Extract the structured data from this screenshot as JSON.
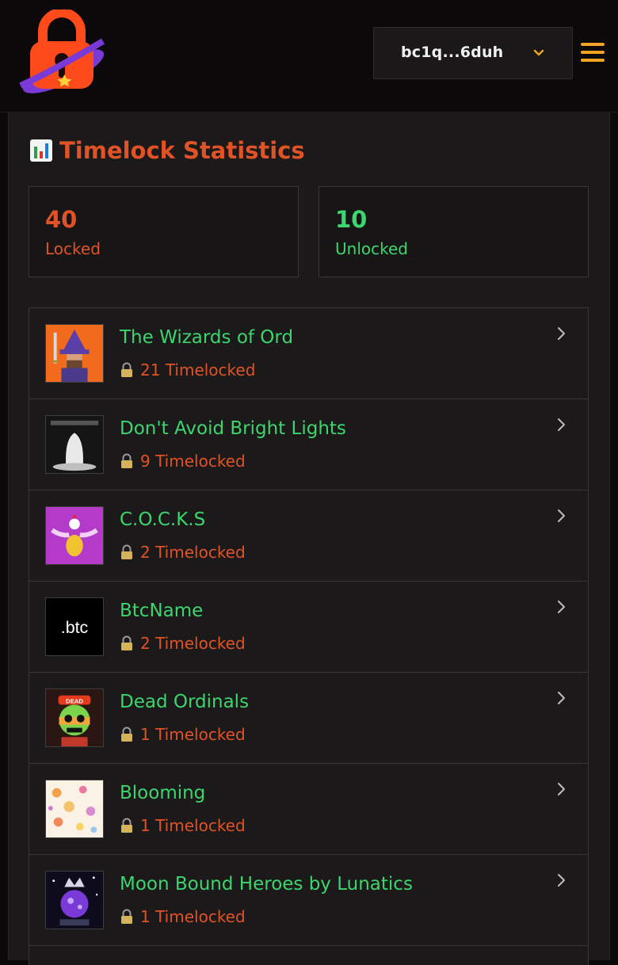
{
  "header": {
    "logo_icon": "padlock-planet-logo",
    "wallet_address": "bc1q...6duh",
    "wallet_dropdown_icon": "chevron-down-icon",
    "menu_icon": "hamburger-menu-icon",
    "accent_color": "#f3a321"
  },
  "stats": {
    "title_icon": "bar-chart-icon",
    "title": "Timelock Statistics",
    "locked": {
      "value": "40",
      "label": "Locked",
      "color": "#e05326"
    },
    "unlocked": {
      "value": "10",
      "label": "Unlocked",
      "color": "#3dd56d"
    }
  },
  "collections": [
    {
      "name": "The Wizards of Ord",
      "count": "21 Timelocked",
      "thumb": "wizard-pixel-art"
    },
    {
      "name": "Don't Avoid Bright Lights",
      "count": "9 Timelocked",
      "thumb": "ghost-figure-art"
    },
    {
      "name": "C.O.C.K.S",
      "count": "2 Timelocked",
      "thumb": "rooster-egg-art"
    },
    {
      "name": "BtcName",
      "count": "2 Timelocked",
      "thumb": "btc-name-logo",
      "thumb_text": ".btc"
    },
    {
      "name": "Dead Ordinals",
      "count": "1 Timelocked",
      "thumb": "skull-dead-art",
      "thumb_text": "DEAD"
    },
    {
      "name": "Blooming",
      "count": "1 Timelocked",
      "thumb": "floral-pattern-art"
    },
    {
      "name": "Moon Bound Heroes by Lunatics",
      "count": "1 Timelocked",
      "thumb": "crowned-moon-hero-art"
    }
  ]
}
